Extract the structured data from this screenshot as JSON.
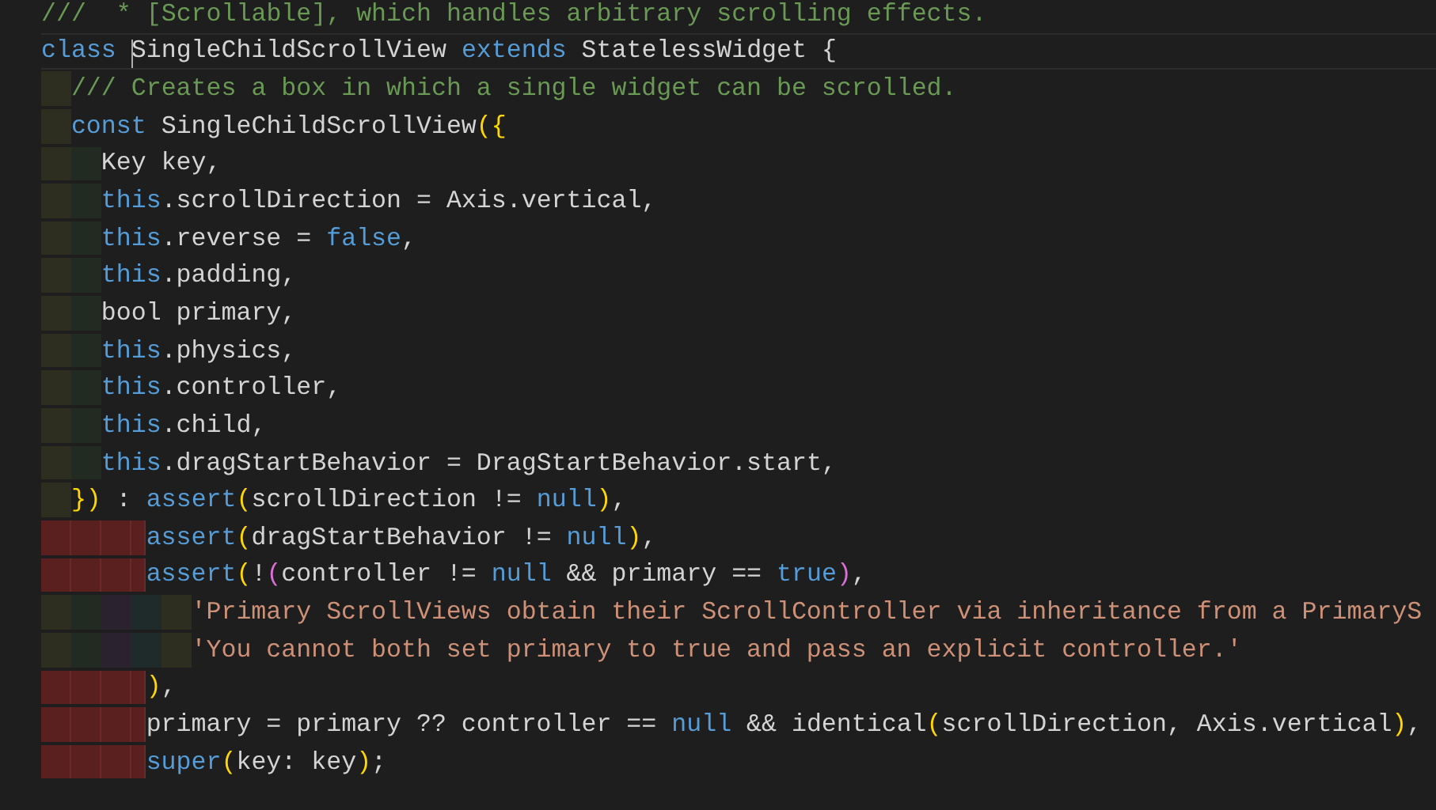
{
  "editor": {
    "lines": [
      {
        "current": false,
        "tokens": [
          {
            "kind": "comment",
            "text": "///  * [Scrollable], which handles arbitrary scrolling effects."
          }
        ]
      },
      {
        "current": true,
        "tokens": [
          {
            "kind": "keyword",
            "text": "class"
          },
          {
            "kind": "plain",
            "text": " SingleChildScrollView "
          },
          {
            "kind": "keyword",
            "text": "extends"
          },
          {
            "kind": "plain",
            "text": " StatelessWidget {"
          }
        ]
      },
      {
        "current": false,
        "guides": [
          {
            "kind": "indent"
          }
        ],
        "tokens": [
          {
            "kind": "comment",
            "text": "/// Creates a box in which a single widget can be scrolled."
          }
        ]
      },
      {
        "current": false,
        "guides": [
          {
            "kind": "indent"
          }
        ],
        "tokens": [
          {
            "kind": "keyword",
            "text": "const"
          },
          {
            "kind": "plain",
            "text": " SingleChildScrollView"
          },
          {
            "kind": "bracket",
            "text": "({"
          }
        ]
      },
      {
        "current": false,
        "guides": [
          {
            "kind": "indent"
          },
          {
            "kind": "indent"
          }
        ],
        "tokens": [
          {
            "kind": "plain",
            "text": "Key key,"
          }
        ]
      },
      {
        "current": false,
        "guides": [
          {
            "kind": "indent"
          },
          {
            "kind": "indent"
          }
        ],
        "tokens": [
          {
            "kind": "keyword",
            "text": "this"
          },
          {
            "kind": "plain",
            "text": ".scrollDirection = Axis.vertical,"
          }
        ]
      },
      {
        "current": false,
        "guides": [
          {
            "kind": "indent"
          },
          {
            "kind": "indent"
          }
        ],
        "tokens": [
          {
            "kind": "keyword",
            "text": "this"
          },
          {
            "kind": "plain",
            "text": ".reverse = "
          },
          {
            "kind": "keyword",
            "text": "false"
          },
          {
            "kind": "plain",
            "text": ","
          }
        ]
      },
      {
        "current": false,
        "guides": [
          {
            "kind": "indent"
          },
          {
            "kind": "indent"
          }
        ],
        "tokens": [
          {
            "kind": "keyword",
            "text": "this"
          },
          {
            "kind": "plain",
            "text": ".padding,"
          }
        ]
      },
      {
        "current": false,
        "guides": [
          {
            "kind": "indent"
          },
          {
            "kind": "indent"
          }
        ],
        "tokens": [
          {
            "kind": "plain",
            "text": "bool primary,"
          }
        ]
      },
      {
        "current": false,
        "guides": [
          {
            "kind": "indent"
          },
          {
            "kind": "indent"
          }
        ],
        "tokens": [
          {
            "kind": "keyword",
            "text": "this"
          },
          {
            "kind": "plain",
            "text": ".physics,"
          }
        ]
      },
      {
        "current": false,
        "guides": [
          {
            "kind": "indent"
          },
          {
            "kind": "indent"
          }
        ],
        "tokens": [
          {
            "kind": "keyword",
            "text": "this"
          },
          {
            "kind": "plain",
            "text": ".controller,"
          }
        ]
      },
      {
        "current": false,
        "guides": [
          {
            "kind": "indent"
          },
          {
            "kind": "indent"
          }
        ],
        "tokens": [
          {
            "kind": "keyword",
            "text": "this"
          },
          {
            "kind": "plain",
            "text": ".child,"
          }
        ]
      },
      {
        "current": false,
        "guides": [
          {
            "kind": "indent"
          },
          {
            "kind": "indent"
          }
        ],
        "tokens": [
          {
            "kind": "keyword",
            "text": "this"
          },
          {
            "kind": "plain",
            "text": ".dragStartBehavior = DragStartBehavior.start,"
          }
        ]
      },
      {
        "current": false,
        "guides": [
          {
            "kind": "indent"
          }
        ],
        "tokens": [
          {
            "kind": "bracket",
            "text": "})"
          },
          {
            "kind": "plain",
            "text": " : "
          },
          {
            "kind": "keyword",
            "text": "assert"
          },
          {
            "kind": "bracket",
            "text": "("
          },
          {
            "kind": "plain",
            "text": "scrollDirection != "
          },
          {
            "kind": "keyword",
            "text": "null"
          },
          {
            "kind": "bracket",
            "text": ")"
          },
          {
            "kind": "plain",
            "text": ","
          }
        ]
      },
      {
        "current": false,
        "guides": [
          {
            "kind": "error"
          },
          {
            "kind": "error"
          },
          {
            "kind": "error"
          },
          {
            "kind": "error_partial"
          }
        ],
        "tokens": [
          {
            "kind": "keyword",
            "text": "assert"
          },
          {
            "kind": "bracket",
            "text": "("
          },
          {
            "kind": "plain",
            "text": "dragStartBehavior != "
          },
          {
            "kind": "keyword",
            "text": "null"
          },
          {
            "kind": "bracket",
            "text": ")"
          },
          {
            "kind": "plain",
            "text": ","
          }
        ]
      },
      {
        "current": false,
        "guides": [
          {
            "kind": "error"
          },
          {
            "kind": "error"
          },
          {
            "kind": "error"
          },
          {
            "kind": "error_partial"
          }
        ],
        "tokens": [
          {
            "kind": "keyword",
            "text": "assert"
          },
          {
            "kind": "bracket",
            "text": "("
          },
          {
            "kind": "plain",
            "text": "!"
          },
          {
            "kind": "bracket2",
            "text": "("
          },
          {
            "kind": "plain",
            "text": "controller != "
          },
          {
            "kind": "keyword",
            "text": "null"
          },
          {
            "kind": "plain",
            "text": " && primary == "
          },
          {
            "kind": "keyword",
            "text": "true"
          },
          {
            "kind": "bracket2",
            "text": ")"
          },
          {
            "kind": "plain",
            "text": ","
          }
        ]
      },
      {
        "current": false,
        "guides": [
          {
            "kind": "indent"
          },
          {
            "kind": "indent"
          },
          {
            "kind": "indent"
          },
          {
            "kind": "indent"
          },
          {
            "kind": "indent"
          }
        ],
        "tokens": [
          {
            "kind": "string",
            "text": "'Primary ScrollViews obtain their ScrollController via inheritance from a PrimaryS"
          }
        ]
      },
      {
        "current": false,
        "guides": [
          {
            "kind": "indent"
          },
          {
            "kind": "indent"
          },
          {
            "kind": "indent"
          },
          {
            "kind": "indent"
          },
          {
            "kind": "indent"
          }
        ],
        "tokens": [
          {
            "kind": "string",
            "text": "'You cannot both set primary to true and pass an explicit controller.'"
          }
        ]
      },
      {
        "current": false,
        "guides": [
          {
            "kind": "error"
          },
          {
            "kind": "error"
          },
          {
            "kind": "error"
          },
          {
            "kind": "error_partial"
          }
        ],
        "tokens": [
          {
            "kind": "bracket",
            "text": ")"
          },
          {
            "kind": "plain",
            "text": ","
          }
        ]
      },
      {
        "current": false,
        "guides": [
          {
            "kind": "error"
          },
          {
            "kind": "error"
          },
          {
            "kind": "error"
          },
          {
            "kind": "error_partial"
          }
        ],
        "tokens": [
          {
            "kind": "plain",
            "text": "primary = primary ?? controller == "
          },
          {
            "kind": "keyword",
            "text": "null"
          },
          {
            "kind": "plain",
            "text": " && identical"
          },
          {
            "kind": "bracket",
            "text": "("
          },
          {
            "kind": "plain",
            "text": "scrollDirection, Axis.vertical"
          },
          {
            "kind": "bracket",
            "text": ")"
          },
          {
            "kind": "plain",
            "text": ","
          }
        ]
      },
      {
        "current": false,
        "guides": [
          {
            "kind": "error"
          },
          {
            "kind": "error"
          },
          {
            "kind": "error"
          },
          {
            "kind": "error_partial"
          }
        ],
        "tokens": [
          {
            "kind": "keyword",
            "text": "super"
          },
          {
            "kind": "bracket",
            "text": "("
          },
          {
            "kind": "plain",
            "text": "key: key"
          },
          {
            "kind": "bracket",
            "text": ")"
          },
          {
            "kind": "plain",
            "text": ";"
          }
        ]
      }
    ]
  }
}
